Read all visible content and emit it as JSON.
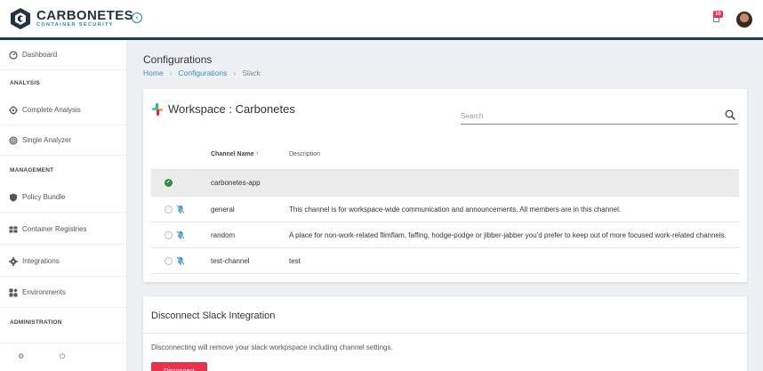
{
  "app": {
    "brand_title": "CARBONETES",
    "brand_subtitle": "CONTAINER SECURITY",
    "notification_count": "10"
  },
  "sidebar": {
    "items": [
      {
        "label": "Dashboard",
        "icon": "dashboard-gauge-icon"
      },
      {
        "label": "Complete Analysis",
        "icon": "crosshair-icon"
      },
      {
        "label": "Single Analyzer",
        "icon": "target-icon"
      },
      {
        "label": "Policy Bundle",
        "icon": "shield-icon"
      },
      {
        "label": "Container Registries",
        "icon": "grid-icon"
      },
      {
        "label": "Integrations",
        "icon": "gear-icon"
      },
      {
        "label": "Environments",
        "icon": "widgets-icon"
      }
    ],
    "sections": {
      "analysis": "ANALYSIS",
      "management": "MANAGEMENT",
      "administration": "ADMINISTRATION"
    }
  },
  "page": {
    "title": "Configurations",
    "breadcrumb": [
      "Home",
      "Configurations",
      "Slack"
    ]
  },
  "workspace": {
    "title": "Workspace : Carbonetes",
    "search_placeholder": "Search",
    "columns": {
      "channel": "Channel Name",
      "description": "Description"
    },
    "channels": [
      {
        "name": "carbonetes-app",
        "description": "",
        "selected": true
      },
      {
        "name": "general",
        "description": "This channel is for workspace-wide communication and announcements. All members are in this channel.",
        "selected": false
      },
      {
        "name": "random",
        "description": "A place for non-work-related flimflam, faffing, hodge-podge or jibber-jabber you'd prefer to keep out of more focused work-related channels.",
        "selected": false
      },
      {
        "name": "test-channel",
        "description": "test",
        "selected": false
      }
    ]
  },
  "disconnect": {
    "title": "Disconnect Slack Integration",
    "text": "Disconnecting will remove your slack workpspace including channel settings.",
    "button": "Disconnect"
  },
  "colors": {
    "accent": "#1f8ca3",
    "header_line": "#1d3c4a",
    "danger": "#e8334f",
    "success": "#23913f",
    "link": "#3a8fc7"
  }
}
